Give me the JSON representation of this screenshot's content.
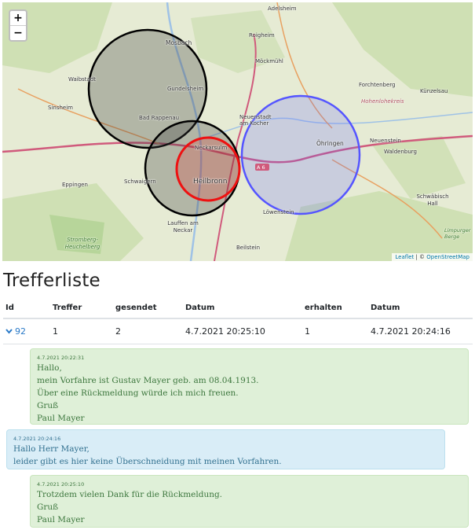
{
  "map": {
    "zoom_in": "+",
    "zoom_out": "−",
    "places": {
      "adelsheim": "Adelsheim",
      "mosbach": "Mosbach",
      "roigheim": "Roigheim",
      "moeckmuehl": "Möckmühl",
      "waibstadt": "Waibstadt",
      "gundelsheim": "Gundelsheim",
      "forchtenberg": "Forchtenberg",
      "kuenzelsau": "Künzelsau",
      "hohenlohekreis": "Hohenlohekreis",
      "sinsheim": "Sinsheim",
      "bad_rappenau": "Bad Rappenau",
      "neuenstadt": "Neuenstadt am Kocher",
      "neckarsulm": "Neckarsulm",
      "oehringen": "Öhringen",
      "neuenstein": "Neuenstein",
      "waldenburg": "Waldenburg",
      "heilbronn": "Heilbronn",
      "a6": "A 6",
      "eppingen": "Eppingen",
      "schwaigern": "Schwaigern",
      "schwaebisch_hall": "Schwäbisch Hall",
      "loewenstein": "Löwenstein",
      "lauffen": "Lauffen am Neckar",
      "limpurger": "Limpurger Berge",
      "stromberg": "Stromberg-Heuchelberg",
      "beilstein": "Beilstein"
    },
    "attribution": {
      "leaflet": "Leaflet",
      "sep": " | © ",
      "osm": "OpenStreetMap"
    },
    "colors": {
      "black_circle": "#000000",
      "red_circle": "#ee1111",
      "blue_circle": "#5555ff"
    }
  },
  "list": {
    "title": "Trefferliste",
    "headers": [
      "Id",
      "Treffer",
      "gesendet",
      "Datum",
      "erhalten",
      "Datum"
    ],
    "row": {
      "id": "92",
      "treffer": "1",
      "gesendet": "2",
      "datum_sent": "4.7.2021 20:25:10",
      "erhalten": "1",
      "datum_recv": "4.7.2021 20:24:16"
    }
  },
  "messages": [
    {
      "ts": "4.7.2021 20:22:31",
      "lines": [
        "Hallo,",
        "mein Vorfahre ist Gustav Mayer geb. am 08.04.1913.",
        "Über eine Rückmeldung würde ich mich freuen.",
        "Gruß",
        "Paul Mayer"
      ]
    },
    {
      "ts": "4.7.2021 20:24:16",
      "lines": [
        "Hallo Herr Mayer,",
        "leider gibt es hier keine Überschneidung mit meinen Vorfahren."
      ]
    },
    {
      "ts": "4.7.2021 20:25:10",
      "lines": [
        "Trotzdem vielen Dank für die Rückmeldung.",
        "Gruß",
        "Paul Mayer"
      ]
    }
  ]
}
